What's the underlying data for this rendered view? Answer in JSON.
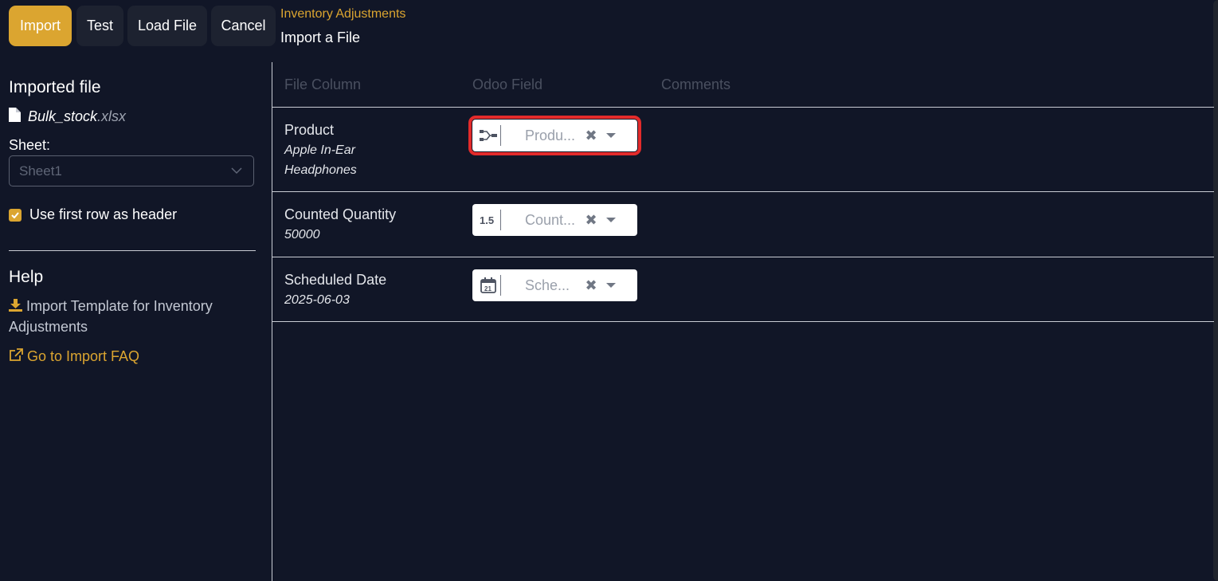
{
  "control_panel": {
    "buttons": {
      "import": "Import",
      "test": "Test",
      "load_file": "Load File",
      "cancel": "Cancel"
    },
    "breadcrumb": {
      "parent": "Inventory Adjustments",
      "current": "Import a File"
    }
  },
  "sidebar": {
    "imported_file_title": "Imported file",
    "file_name": "Bulk_stock",
    "file_ext": ".xlsx",
    "sheet_label": "Sheet:",
    "sheet_value": "Sheet1",
    "header_checkbox_label": "Use first row as header",
    "header_checkbox_checked": true,
    "help_title": "Help",
    "help_template_link": "Import Template for Inventory Adjustments",
    "help_faq_link": "Go to Import FAQ"
  },
  "table": {
    "headers": {
      "file_column": "File Column",
      "odoo_field": "Odoo Field",
      "comments": "Comments"
    },
    "rows": [
      {
        "label": "Product",
        "sample": "Apple In-Ear Headphones",
        "field": "Produ...",
        "field_icon": "many2one-icon"
      },
      {
        "label": "Counted Quantity",
        "sample": "50000",
        "field": "Count...",
        "field_icon": "float-icon"
      },
      {
        "label": "Scheduled Date",
        "sample": "2025-06-03",
        "field": "Sche...",
        "field_icon": "calendar-icon"
      }
    ]
  },
  "colors": {
    "accent": "#dba530",
    "background": "#111627",
    "highlight": "#e32b2b"
  }
}
